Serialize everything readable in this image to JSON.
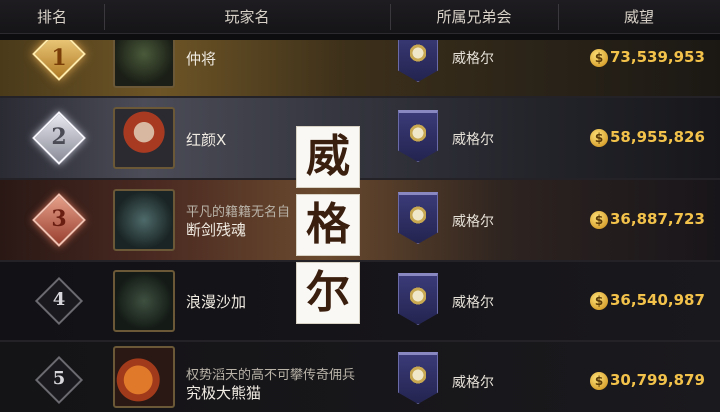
{
  "header": {
    "rank": "排名",
    "player": "玩家名",
    "guild": "所属兄弟会",
    "prestige": "威望"
  },
  "rows": [
    {
      "rank": "1",
      "tier": "gold",
      "title": "",
      "name": "仲将",
      "guild": "威格尔",
      "prestige": "73,539,953"
    },
    {
      "rank": "2",
      "tier": "silver",
      "title": "",
      "name": "红颜X",
      "guild": "威格尔",
      "prestige": "58,955,826"
    },
    {
      "rank": "3",
      "tier": "bronze",
      "title": "平凡的籍籍无名自",
      "name": "断剑残魂",
      "guild": "威格尔",
      "prestige": "36,887,723"
    },
    {
      "rank": "4",
      "tier": "plain",
      "title": "",
      "name": "浪漫沙加",
      "guild": "威格尔",
      "prestige": "36,540,987"
    },
    {
      "rank": "5",
      "tier": "plain",
      "title": "权势滔天的高不可攀传奇佣兵",
      "name": "究极大熊猫",
      "guild": "威格尔",
      "prestige": "30,799,879"
    }
  ],
  "overlay_chars": [
    "威",
    "格",
    "尔"
  ],
  "icons": {
    "rank_badge": "diamond-badge-icon",
    "guild_banner": "banner-icon",
    "prestige_coin": "prestige-coin-icon"
  },
  "colors": {
    "prestige_text": "#f2c24a",
    "gold_badge": "#e0aa4a",
    "silver_badge": "#c0c2cc",
    "bronze_badge": "#c86a50",
    "guild_banner": "#2e2e64"
  }
}
